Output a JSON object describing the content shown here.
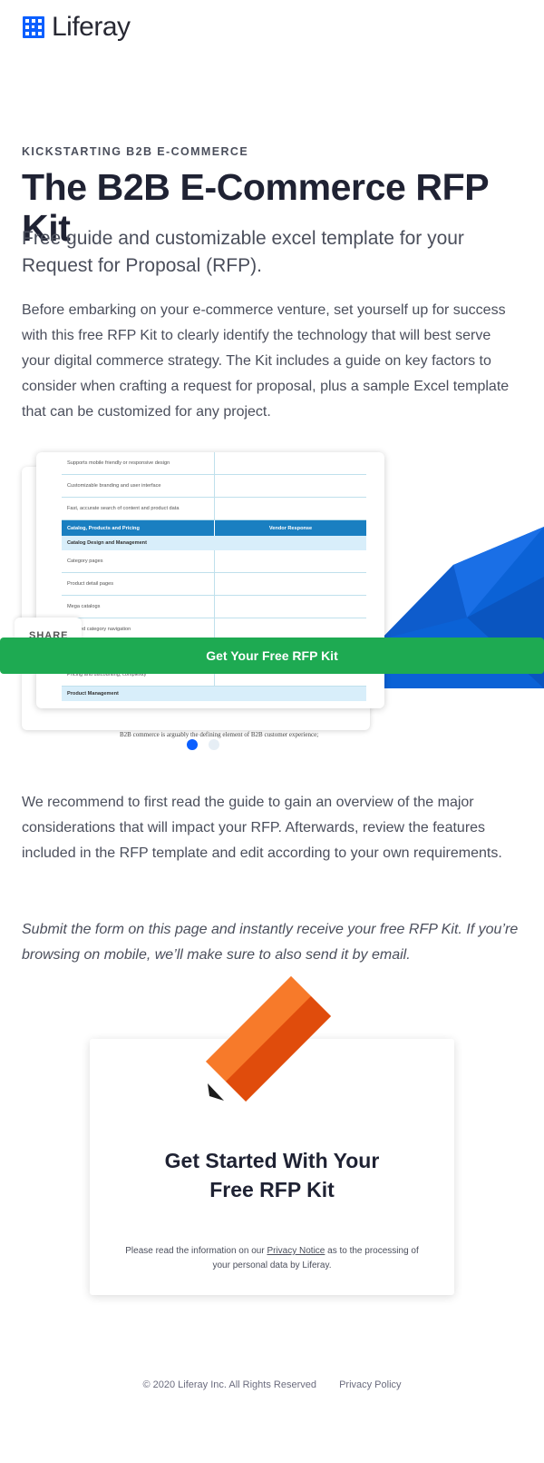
{
  "brand": {
    "name": "Liferay",
    "color": "#0b5fff"
  },
  "hero": {
    "eyebrow": "KICKSTARTING B2B E-COMMERCE",
    "title": "The B2B E-Commerce RFP Kit",
    "subtitle": "Free guide and customizable excel template for your Request for Proposal (RFP).",
    "body": "Before embarking on your e-commerce venture, set yourself up for success with this free RFP Kit to clearly identify the technology that will best serve your digital commerce strategy. The Kit includes a guide on key factors to consider when crafting a request for proposal, plus a sample Excel template that can be customized for any project."
  },
  "preview": {
    "rows_top": [
      "Supports mobile friendly or responsive design",
      "Customizable branding and user interface",
      "Fast, accurate search of content and product data"
    ],
    "header": {
      "col1": "Catalog, Products and Pricing",
      "col2": "Vendor Response"
    },
    "subheader": "Catalog Design and Management",
    "rows_mid": [
      "Category pages",
      "Product detail pages",
      "Mega catalogs",
      "Faceted category navigation"
    ],
    "rows_bottom_partial": "Pricing and discounting, complexity",
    "subheader2": "Product Management",
    "back_text": "B2B commerce is arguably the defining element of B2B customer experience;"
  },
  "share_label": "SHARE",
  "cta_label": "Get Your Free RFP Kit",
  "cta_color": "#1eaa52",
  "carousel": {
    "active_index": 0,
    "count": 2
  },
  "content": {
    "recommend": "We recommend to first read the guide to gain an overview of the major considerations that will impact your RFP. Afterwards, review the features included in the RFP template and edit according to your own requirements.",
    "submit": "Submit the form on this page and instantly receive your free RFP Kit. If you’re browsing on mobile, we’ll make sure to also send it by email."
  },
  "form_card": {
    "title_line1": "Get Started With Your",
    "title_line2": "Free RFP Kit",
    "note_before": "Please read the information on our ",
    "note_link": "Privacy Notice",
    "note_after": " as to the processing of your personal data by Liferay."
  },
  "footer": {
    "copyright": "© 2020 Liferay Inc. All Rights Reserved",
    "privacy_link": "Privacy Policy"
  }
}
